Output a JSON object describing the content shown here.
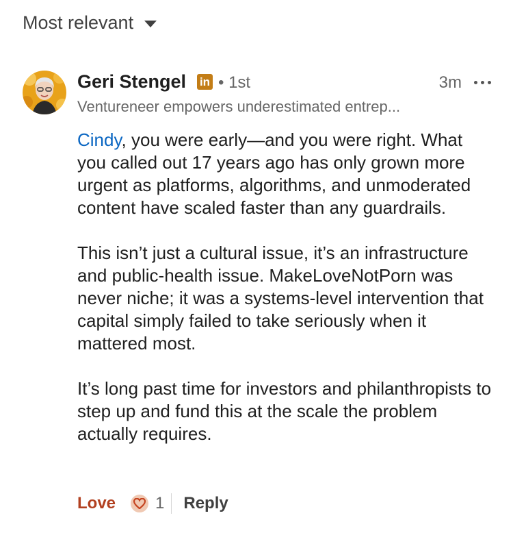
{
  "sort": {
    "label": "Most relevant"
  },
  "comment": {
    "author": "Geri Stengel",
    "linkedin_badge": "in",
    "degree": "• 1st",
    "time": "3m",
    "headline": "Ventureneer empowers underestimated entrep...",
    "mention": "Cindy",
    "paragraph1_rest": ", you were early—and you were right. What you called out 17 years ago has only grown more urgent as platforms, algorithms, and unmoderated content have scaled faster than any guardrails.",
    "paragraph2": "This isn’t just a cultural issue, it’s an infrastructure and public-health issue. MakeLoveNotPorn was never niche; it was a systems-level intervention that capital simply failed to take seriously when it mattered most.",
    "paragraph3": "It’s long past time for investors and philanthropists to step up and fund this at the scale the problem actually requires."
  },
  "actions": {
    "love_label": "Love",
    "reaction_count": "1",
    "reply_label": "Reply"
  },
  "colors": {
    "mention": "#0a66c2",
    "love": "#b24020",
    "badge": "#c37d16"
  },
  "icons": {
    "sort_caret": "caret-down-icon",
    "more": "more-horizontal-icon",
    "reaction": "love-heart-icon"
  }
}
